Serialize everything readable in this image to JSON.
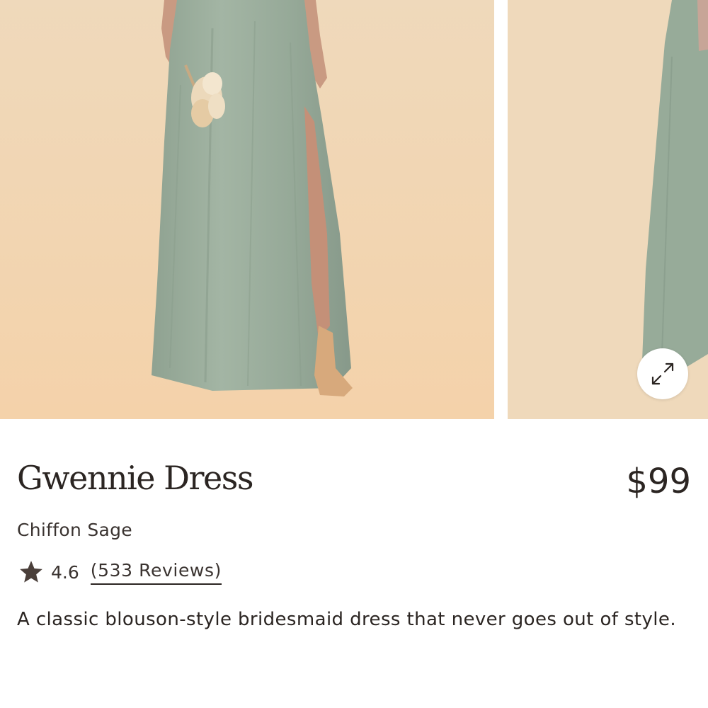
{
  "gallery": {
    "images": [
      {
        "subject": "model in sage chiffon dress holding dried bouquet"
      },
      {
        "subject": "sage chiffon dress side view"
      }
    ],
    "expand_icon": "expand-arrows-icon"
  },
  "product": {
    "name": "Gwennie Dress",
    "price": "$99",
    "color": "Chiffon Sage",
    "rating": {
      "star_icon": "star-icon",
      "score": "4.6",
      "reviews_label": "(533 Reviews)"
    },
    "description": "A classic blouson-style bridesmaid dress that never goes out of style."
  },
  "colors": {
    "text": "#2b2522",
    "backdrop": "#efd9bb",
    "dress": "#9fb0a0"
  }
}
